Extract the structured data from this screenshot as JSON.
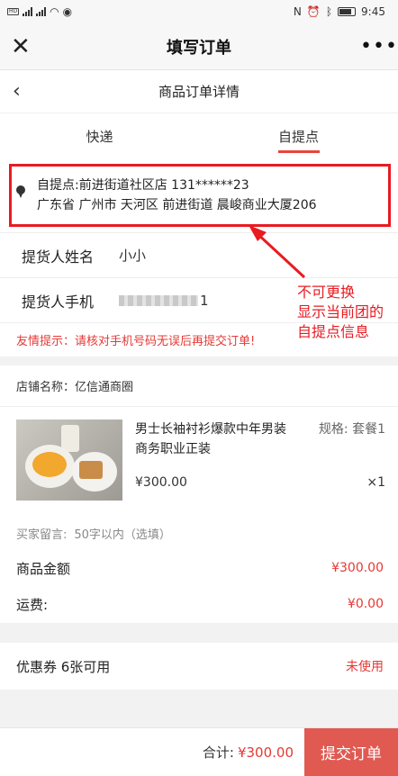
{
  "status": {
    "time": "9:45"
  },
  "titlebar": {
    "title": "填写订单"
  },
  "subheader": {
    "title": "商品订单详情"
  },
  "tabs": [
    {
      "label": "快递"
    },
    {
      "label": "自提点"
    }
  ],
  "pickup": {
    "line1": "自提点:前进街道社区店 131******23",
    "line2": "广东省 广州市 天河区 前进街道 晨峻商业大厦206"
  },
  "form": {
    "name_label": "提货人姓名",
    "name_value": "小小",
    "phone_label": "提货人手机",
    "phone_suffix": "1"
  },
  "tip": "友情提示：请核对手机号码无误后再提交订单!",
  "annotation": {
    "line1": "不可更换",
    "line2": "显示当前团的",
    "line3": "自提点信息"
  },
  "store": {
    "label": "店铺名称：亿信通商圈"
  },
  "product": {
    "name": "男士长袖衬衫爆款中年男装商务职业正装",
    "spec": "规格: 套餐1",
    "price": "¥300.00",
    "qty": "×1"
  },
  "message": {
    "label": "买家留言:",
    "placeholder": "50字以内（选填）"
  },
  "amounts": {
    "goods_label": "商品金额",
    "goods_value": "¥300.00",
    "shipping_label": "运费:",
    "shipping_value": "¥0.00"
  },
  "coupon": {
    "label": "优惠券 6张可用",
    "status": "未使用"
  },
  "footer": {
    "total_label": "合计:",
    "total_value": "¥300.00",
    "submit": "提交订单"
  },
  "colors": {
    "accent": "#e53935",
    "highlight_box": "#e81b21",
    "submit_bg": "#e05a52"
  }
}
